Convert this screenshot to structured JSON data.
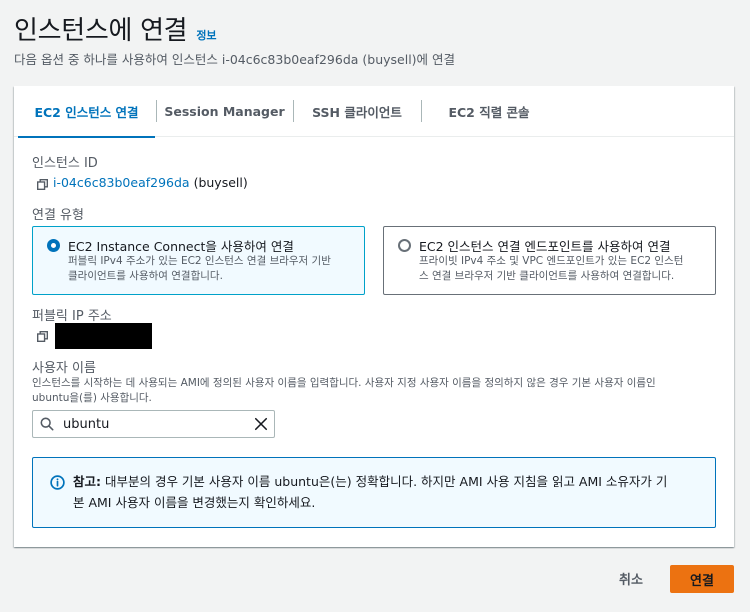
{
  "header": {
    "title": "인스턴스에 연결",
    "info_link": "정보",
    "subtitle": "다음 옵션 중 하나를 사용하여 인스턴스 i-04c6c83b0eaf296da (buysell)에 연결"
  },
  "tabs": [
    {
      "label": "EC2 인스턴스 연결",
      "active": true
    },
    {
      "label": "Session Manager",
      "active": false
    },
    {
      "label": "SSH 클라이언트",
      "active": false
    },
    {
      "label": "EC2 직렬 콘솔",
      "active": false
    }
  ],
  "instance": {
    "label": "인스턴스 ID",
    "id": "i-04c6c83b0eaf296da",
    "name": "(buysell)"
  },
  "connection_type": {
    "label": "연결 유형",
    "options": [
      {
        "title": "EC2 Instance Connect을 사용하여 연결",
        "desc_line1": "퍼블릭 IPv4 주소가 있는 EC2 인스턴스 연결 브라우저 기반",
        "desc_line2": "클라이언트를 사용하여 연결합니다.",
        "selected": true
      },
      {
        "title": "EC2 인스턴스 연결 엔드포인트를 사용하여 연결",
        "desc_line1": "프라이빗 IPv4 주소 및 VPC 엔드포인트가 있는 EC2 인스턴",
        "desc_line2": "스 연결 브라우저 기반 클라이언트를 사용하여 연결합니다.",
        "selected": false
      }
    ]
  },
  "public_ip": {
    "label": "퍼블릭 IP 주소"
  },
  "username": {
    "label": "사용자 이름",
    "desc_line1": "인스턴스를 시작하는 데 사용되는 AMI에 정의된 사용자 이름을 입력합니다. 사용자 지정 사용자 이름을 정의하지 않은 경우 기본 사용자 이름인",
    "desc_line2": "ubuntu을(를) 사용합니다.",
    "value": "ubuntu"
  },
  "alert": {
    "bold": "참고:",
    "line1": " 대부분의 경우 기본 사용자 이름 ubuntu은(는) 정확합니다. 하지만 AMI 사용 지침을 읽고 AMI 소유자가 기",
    "line2": "본 AMI 사용자 이름을 변경했는지 확인하세요."
  },
  "footer": {
    "cancel": "취소",
    "connect": "연결"
  },
  "colors": {
    "accent": "#0073bb",
    "primary_button": "#ec7211"
  }
}
